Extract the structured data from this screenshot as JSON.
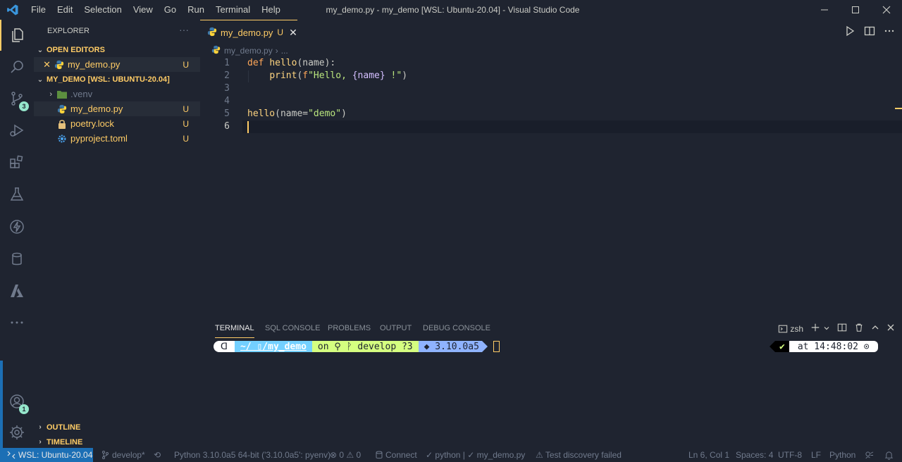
{
  "titlebar": {
    "menu": [
      "File",
      "Edit",
      "Selection",
      "View",
      "Go",
      "Run",
      "Terminal",
      "Help"
    ],
    "title": "my_demo.py - my_demo [WSL: Ubuntu-20.04] - Visual Studio Code"
  },
  "activity": {
    "source_control_badge": "3",
    "accounts_badge": "1"
  },
  "sidebar": {
    "title": "EXPLORER",
    "more": "···",
    "open_editors": {
      "header": "OPEN EDITORS",
      "items": [
        {
          "name": "my_demo.py",
          "status": "U"
        }
      ]
    },
    "workspace": {
      "header": "MY_DEMO [WSL: UBUNTU-20.04]",
      "items": [
        {
          "name": ".venv",
          "status": ""
        },
        {
          "name": "my_demo.py",
          "status": "U"
        },
        {
          "name": "poetry.lock",
          "status": "U"
        },
        {
          "name": "pyproject.toml",
          "status": "U"
        }
      ]
    },
    "outline": "OUTLINE",
    "timeline": "TIMELINE"
  },
  "editor": {
    "tab": {
      "label": "my_demo.py",
      "status": "U"
    },
    "breadcrumb": {
      "file": "my_demo.py",
      "rest": "..."
    },
    "line_numbers": [
      "1",
      "2",
      "3",
      "4",
      "5",
      "6"
    ],
    "code": {
      "l1_kw": "def",
      "l1_fn": "hello",
      "l1_rest": "(name):",
      "l2_indent": "    ",
      "l2_fn": "print",
      "l2_open": "(",
      "l2_f": "f",
      "l2_str_a": "\"Hello, ",
      "l2_interp": "{name}",
      "l2_str_b": " !\"",
      "l2_close": ")",
      "l5_fn": "hello",
      "l5_a": "(name=",
      "l5_str": "\"demo\"",
      "l5_close": ")"
    }
  },
  "panel": {
    "tabs": [
      "TERMINAL",
      "SQL CONSOLE",
      "PROBLEMS",
      "OUTPUT",
      "DEBUG CONSOLE"
    ],
    "shell": "zsh",
    "prompt": {
      "os_glyph": "ᗡ",
      "path": "~/ ▯/my_demo",
      "git": "on ⚲ ᚹ develop ?3",
      "python": "◆ 3.10.0a5",
      "check": "✔",
      "time": "at 14:48:02 ⊙"
    }
  },
  "status": {
    "remote": "WSL: Ubuntu-20.04",
    "branch": "develop*",
    "python": "Python 3.10.0a5 64-bit ('3.10.0a5': pyenv)",
    "problems": "⊗ 0 ⚠ 0",
    "connect": "Connect",
    "python_check": "✓ python | ✓ my_demo.py",
    "test": "⚠ Test discovery failed",
    "position": "Ln 6, Col 1",
    "spaces": "Spaces: 4",
    "encoding": "UTF-8",
    "eol": "LF",
    "language": "Python"
  },
  "colors": {
    "accent": "#ffcc66",
    "remote": "#1c6fb5",
    "background": "#1f2430"
  }
}
